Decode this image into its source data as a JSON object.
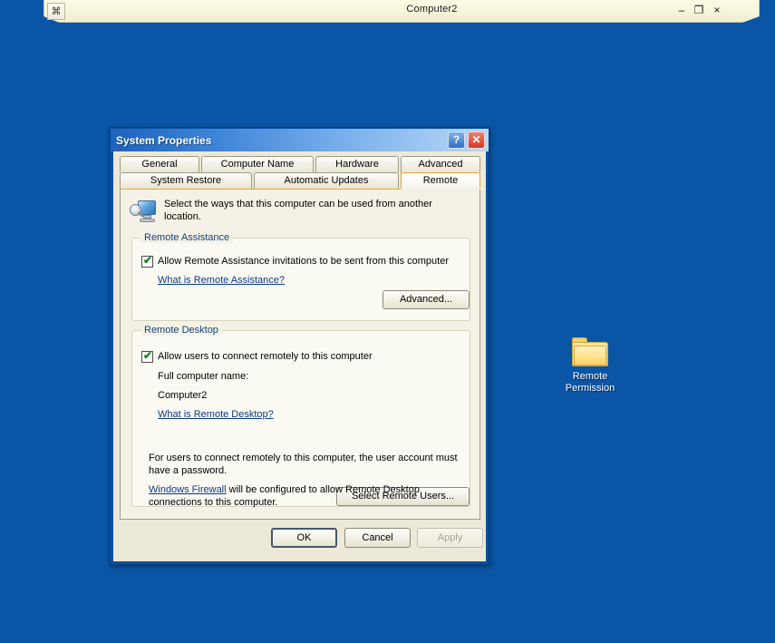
{
  "desktop": {
    "background_color": "#0a55a5",
    "icons": [
      {
        "name": "folder-icon",
        "label_line1": "Remote",
        "label_line2": "Permission"
      }
    ]
  },
  "host_window": {
    "title": "Computer2",
    "sysmenu_glyph": "⌘",
    "minimize_glyph": "–",
    "maximize_glyph": "❐",
    "close_glyph": "×"
  },
  "dialog": {
    "title": "System Properties",
    "help_glyph": "?",
    "close_glyph": "✕",
    "tabs_row1": [
      {
        "label": "General",
        "selected": false
      },
      {
        "label": "Computer Name",
        "selected": false
      },
      {
        "label": "Hardware",
        "selected": false
      },
      {
        "label": "Advanced",
        "selected": false
      }
    ],
    "tabs_row2": [
      {
        "label": "System Restore",
        "selected": false
      },
      {
        "label": "Automatic Updates",
        "selected": false
      },
      {
        "label": "Remote",
        "selected": true
      }
    ],
    "panel": {
      "header_text": "Select the ways that this computer can be used from another location.",
      "remote_assistance": {
        "legend": "Remote Assistance",
        "checkbox_label": "Allow Remote Assistance invitations to be sent from this computer",
        "checkbox_checked": true,
        "checkbox_tick": "✔",
        "link": "What is Remote Assistance?",
        "advanced_button": "Advanced..."
      },
      "remote_desktop": {
        "legend": "Remote Desktop",
        "checkbox_label": "Allow users to connect remotely to this computer",
        "checkbox_checked": true,
        "checkbox_tick": "✔",
        "full_computer_name_label": "Full computer name:",
        "full_computer_name_value": "Computer2",
        "link": "What is Remote Desktop?",
        "select_users_button": "Select Remote Users...",
        "password_note": "For users to connect remotely to this computer, the user account must have a password.",
        "firewall_link": "Windows Firewall",
        "firewall_note_rest": " will be configured to allow Remote Desktop connections to this computer."
      }
    },
    "footer": {
      "ok_label": "OK",
      "cancel_label": "Cancel",
      "apply_label": "Apply",
      "apply_disabled": true
    }
  },
  "colors": {
    "desktop_blue": "#0a55a5",
    "dialog_frame_blue": "#0a4fa0",
    "active_tab_accent": "#e8a33d",
    "legend_text": "#16427c",
    "link_blue": "#0c3a8c",
    "check_green": "#14801f",
    "panel_bg": "#f4f2e7",
    "group_bg": "#faf9f2",
    "host_titlebar_cream": "#f7f6dd"
  }
}
